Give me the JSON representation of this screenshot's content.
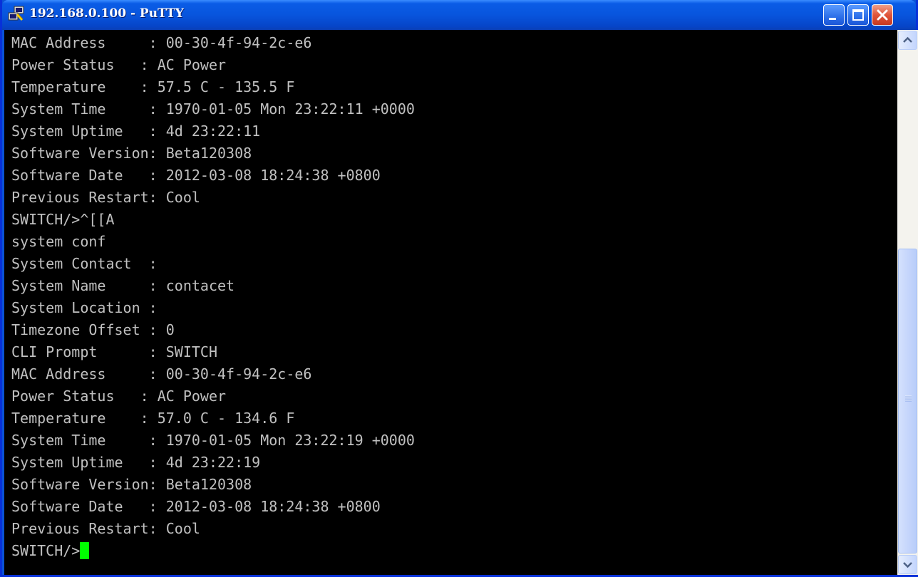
{
  "window": {
    "title": "192.168.0.100 - PuTTY"
  },
  "icons": {
    "app": "putty-icon",
    "minimize": "minimize-icon",
    "maximize": "maximize-icon",
    "close": "close-icon",
    "scroll_up": "chevron-up-icon",
    "scroll_down": "chevron-down-icon"
  },
  "terminal": {
    "lines": [
      "MAC Address     : 00-30-4f-94-2c-e6",
      "Power Status   : AC Power",
      "Temperature    : 57.5 C - 135.5 F",
      "System Time     : 1970-01-05 Mon 23:22:11 +0000",
      "System Uptime   : 4d 23:22:11",
      "Software Version: Beta120308",
      "Software Date   : 2012-03-08 18:24:38 +0800",
      "Previous Restart: Cool",
      "SWITCH/>^[[A",
      "system conf",
      "System Contact  :",
      "System Name     : contacet",
      "System Location :",
      "Timezone Offset : 0",
      "CLI Prompt      : SWITCH",
      "MAC Address     : 00-30-4f-94-2c-e6",
      "Power Status   : AC Power",
      "Temperature    : 57.0 C - 134.6 F",
      "System Time     : 1970-01-05 Mon 23:22:19 +0000",
      "System Uptime   : 4d 23:22:19",
      "Software Version: Beta120308",
      "Software Date   : 2012-03-08 18:24:38 +0800",
      "Previous Restart: Cool"
    ],
    "prompt": "SWITCH/>",
    "cursor_color": "#00ff00",
    "text_color": "#c0c0c0",
    "background": "#000000"
  },
  "scrollbar": {
    "position_fraction": 0.52
  }
}
